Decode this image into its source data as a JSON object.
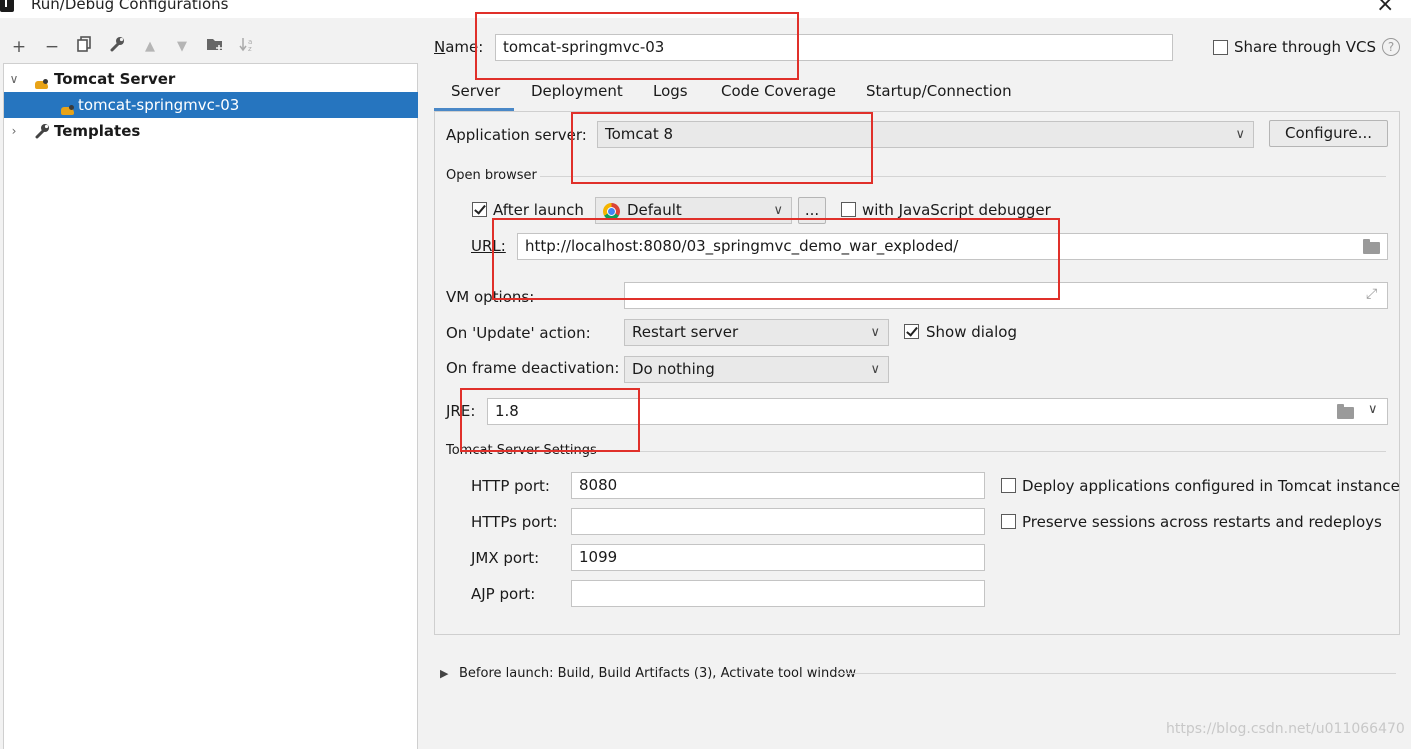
{
  "window": {
    "title": "Run/Debug Configurations"
  },
  "toolbar": {
    "add": "+",
    "remove": "−",
    "copy": "⧉",
    "edit": "🔧",
    "up": "▲",
    "down": "▼",
    "folder": "📁",
    "sort": "↓ª"
  },
  "tree": {
    "group": {
      "label": "Tomcat Server",
      "expanded": true
    },
    "config": {
      "label": "tomcat-springmvc-03",
      "selected": true
    },
    "templates": {
      "label": "Templates"
    }
  },
  "header": {
    "name_label_prefix": "N",
    "name_label_rest": "ame:",
    "name_value": "tomcat-springmvc-03",
    "share_label": "Share through VCS",
    "help": "?"
  },
  "tabs": [
    "Server",
    "Deployment",
    "Logs",
    "Code Coverage",
    "Startup/Connection"
  ],
  "server": {
    "app_server_label": "Application server:",
    "app_server_value": "Tomcat 8",
    "configure_label": "Configure...",
    "open_browser_title": "Open browser",
    "after_launch_label": "After launch",
    "after_launch_checked": true,
    "browser_value": "Default",
    "more_label": "...",
    "js_debugger_label": "with JavaScript debugger",
    "js_debugger_checked": false,
    "url_label": "URL:",
    "url_value": "http://localhost:8080/03_springmvc_demo_war_exploded/",
    "vm_label": "VM options:",
    "vm_value": "",
    "update_label": "On 'Update' action:",
    "update_value": "Restart server",
    "show_dialog_label": "Show dialog",
    "show_dialog_checked": true,
    "frame_label": "On frame deactivation:",
    "frame_value": "Do nothing",
    "jre_label": "JRE:",
    "jre_value": "1.8",
    "tomcat_settings_title": "Tomcat Server Settings",
    "http_label": "HTTP port:",
    "http_value": "8080",
    "https_label": "HTTPs port:",
    "https_value": "",
    "jmx_label": "JMX port:",
    "jmx_value": "1099",
    "ajp_label": "AJP port:",
    "ajp_value": "",
    "deploy_label": "Deploy applications configured in Tomcat instance",
    "preserve_label": "Preserve sessions across restarts and redeploys"
  },
  "before_launch": {
    "label": "Before launch: Build, Build Artifacts (3), Activate tool window"
  },
  "watermark": "https://blog.csdn.net/u011066470",
  "colors": {
    "selection": "#2675bf",
    "annotation_red": "#e0302a",
    "tab_underline": "#4a88c7"
  }
}
